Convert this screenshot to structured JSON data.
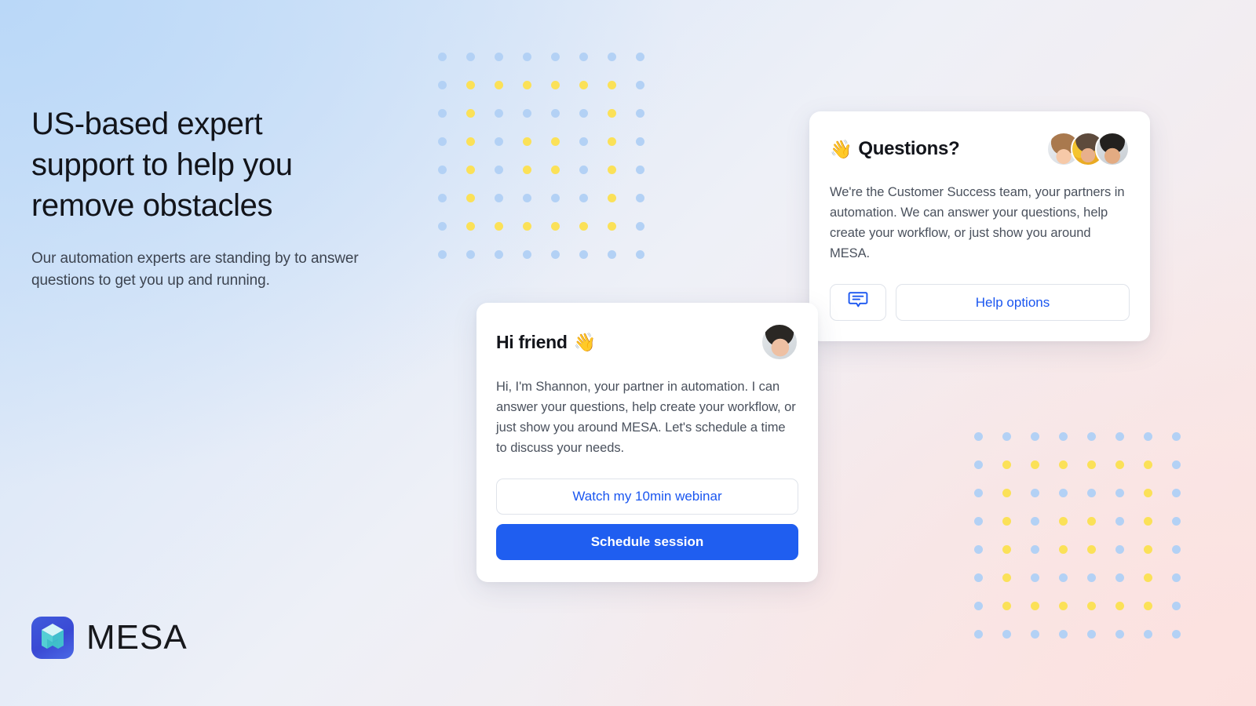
{
  "theme": {
    "primary_blue": "#1f5ef0",
    "link_blue": "#1a56f0",
    "dot_blue": "#b3d1f5",
    "dot_yellow": "#fbe158",
    "bg_top_left": "#cfe2f9",
    "bg_bottom_right": "#fbe7e5",
    "card_bg": "#ffffff",
    "heading_color": "#12141a",
    "body_color": "#4a515d"
  },
  "hero": {
    "title": "US-based expert support to help you remove obstacles",
    "subtitle": "Our automation experts are standing by to answer questions to get you up and running."
  },
  "questions_card": {
    "wave_emoji": "👋",
    "title": "Questions?",
    "body": "We're the Customer Success team, your partners in automation. We can answer your questions, help create your workflow, or just show you around MESA.",
    "chat_button_label": "",
    "help_button_label": "Help options",
    "avatars": [
      {
        "name": "customer-success-member-1"
      },
      {
        "name": "customer-success-member-2"
      },
      {
        "name": "customer-success-member-3"
      }
    ]
  },
  "friend_card": {
    "wave_emoji": "👋",
    "title": "Hi friend",
    "body": "Hi, I'm Shannon, your partner in automation. I can answer your questions, help create your workflow, or just show you around MESA. Let's schedule a time to discuss your needs.",
    "secondary_button_label": "Watch my 10min webinar",
    "primary_button_label": "Schedule session",
    "avatar_name": "shannon-avatar"
  },
  "logo": {
    "wordmark": "MESA",
    "mark_name": "mesa-cube-logo"
  },
  "dot_grids": {
    "rows": 8,
    "cols": 8,
    "spacing": 36,
    "pattern": [
      [
        "blue",
        "blue",
        "blue",
        "blue",
        "blue",
        "blue",
        "blue",
        "blue"
      ],
      [
        "blue",
        "yellow",
        "yellow",
        "yellow",
        "yellow",
        "yellow",
        "yellow",
        "blue"
      ],
      [
        "blue",
        "yellow",
        "blue",
        "blue",
        "blue",
        "blue",
        "yellow",
        "blue"
      ],
      [
        "blue",
        "yellow",
        "blue",
        "yellow",
        "yellow",
        "blue",
        "yellow",
        "blue"
      ],
      [
        "blue",
        "yellow",
        "blue",
        "yellow",
        "yellow",
        "blue",
        "yellow",
        "blue"
      ],
      [
        "blue",
        "yellow",
        "blue",
        "blue",
        "blue",
        "blue",
        "yellow",
        "blue"
      ],
      [
        "blue",
        "yellow",
        "yellow",
        "yellow",
        "yellow",
        "yellow",
        "yellow",
        "blue"
      ],
      [
        "blue",
        "blue",
        "blue",
        "blue",
        "blue",
        "blue",
        "blue",
        "blue"
      ]
    ]
  }
}
